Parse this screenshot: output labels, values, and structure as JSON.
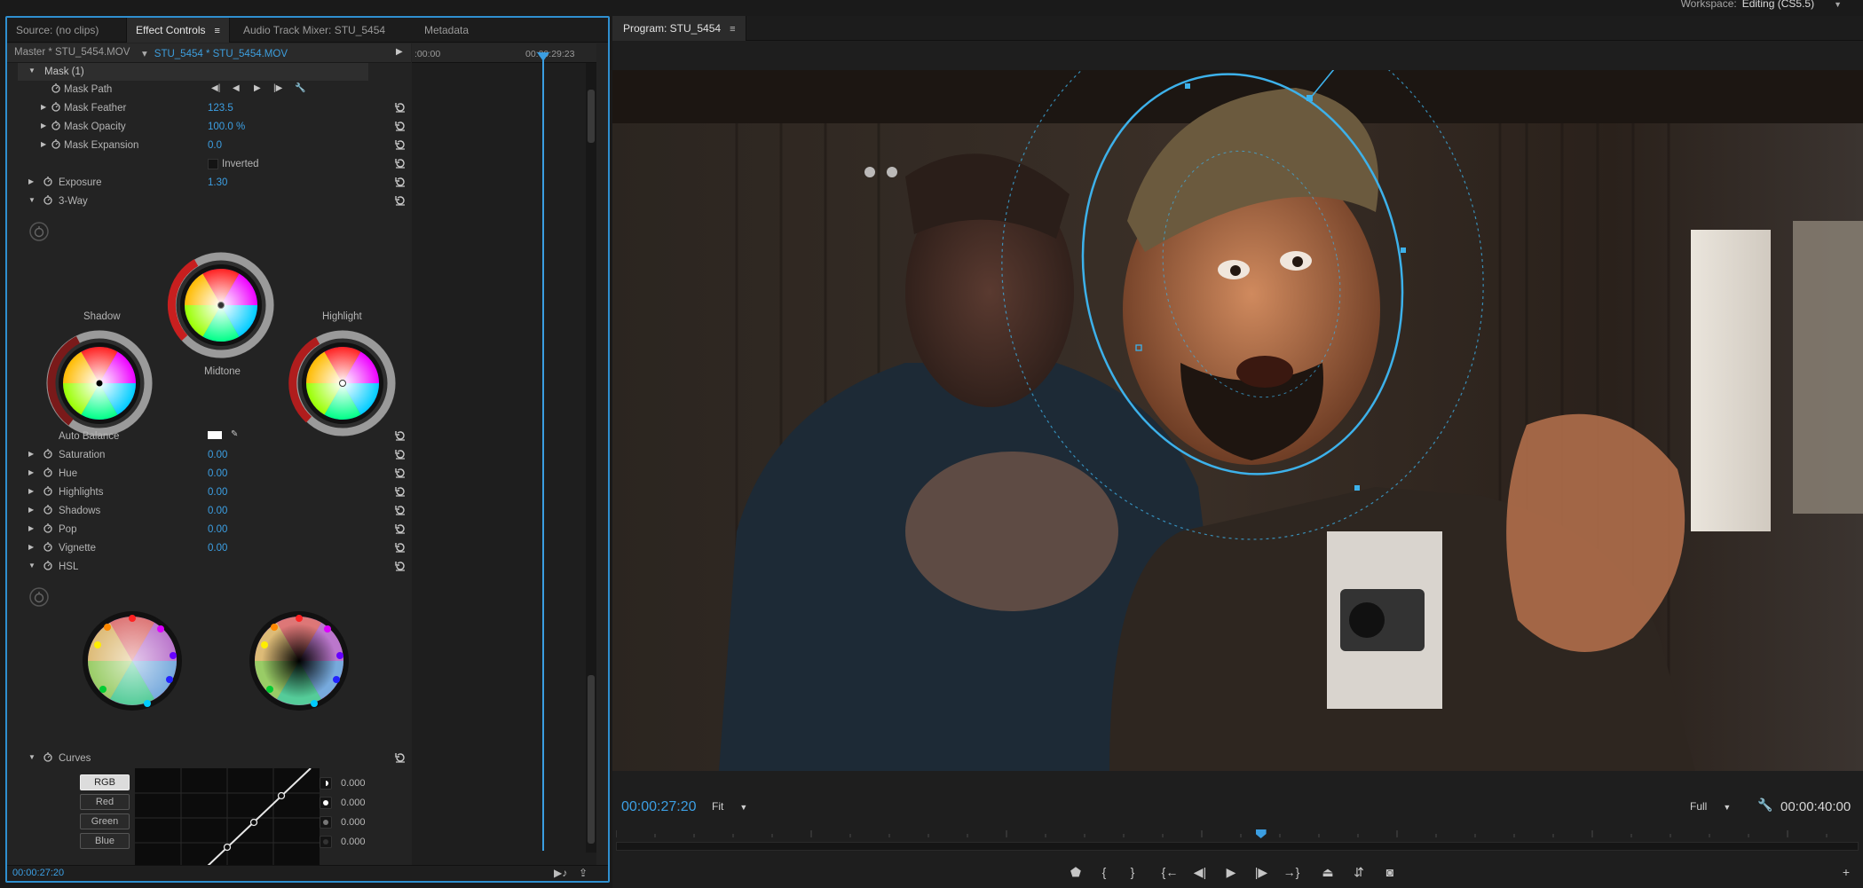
{
  "app": {
    "workspace_label": "Workspace:",
    "workspace_value": "Editing (CS5.5)"
  },
  "left_panel": {
    "tabs": [
      "Source: (no clips)",
      "Effect Controls",
      "Audio Track Mixer: STU_5454",
      "Metadata"
    ],
    "active_tab": "Effect Controls",
    "master_label": "Master * STU_5454.MOV",
    "sequence_label": "STU_5454 * STU_5454.MOV",
    "timeline": {
      "start": ":00:00",
      "marker": "00:00:29:23"
    },
    "mask": {
      "header": "Mask (1)",
      "path_label": "Mask Path",
      "feather_label": "Mask Feather",
      "feather_value": "123.5",
      "opacity_label": "Mask Opacity",
      "opacity_value": "100.0 %",
      "expansion_label": "Mask Expansion",
      "expansion_value": "0.0",
      "inverted_label": "Inverted"
    },
    "exposure": {
      "label": "Exposure",
      "value": "1.30"
    },
    "three_way": {
      "label": "3-Way",
      "shadow_label": "Shadow",
      "midtone_label": "Midtone",
      "highlight_label": "Highlight"
    },
    "auto_balance_label": "Auto Balance",
    "params": [
      {
        "label": "Saturation",
        "value": "0.00"
      },
      {
        "label": "Hue",
        "value": "0.00"
      },
      {
        "label": "Highlights",
        "value": "0.00"
      },
      {
        "label": "Shadows",
        "value": "0.00"
      },
      {
        "label": "Pop",
        "value": "0.00"
      },
      {
        "label": "Vignette",
        "value": "0.00"
      }
    ],
    "hsl_label": "HSL",
    "curves": {
      "label": "Curves",
      "buttons": [
        "RGB",
        "Red",
        "Green",
        "Blue"
      ],
      "active": "RGB",
      "values": [
        "0.000",
        "0.000",
        "0.000",
        "0.000"
      ]
    },
    "timecode": "00:00:27:20"
  },
  "program": {
    "tab": "Program: STU_5454",
    "timecode": "00:00:27:20",
    "fit": "Fit",
    "resolution": "Full",
    "duration": "00:00:40:00",
    "playhead_fraction": 0.519
  },
  "icons": [
    "menu-icon",
    "stopwatch-icon",
    "reset-icon",
    "wrench-icon",
    "eyedropper-icon",
    "play-icon",
    "marker-icon",
    "in-point-icon",
    "out-point-icon",
    "go-to-in-icon",
    "step-back-icon",
    "step-forward-icon",
    "go-to-out-icon",
    "lift-icon",
    "extract-icon",
    "camera-icon",
    "add-icon"
  ],
  "colors": {
    "accent": "#3c9fe3",
    "panel": "#232323"
  }
}
